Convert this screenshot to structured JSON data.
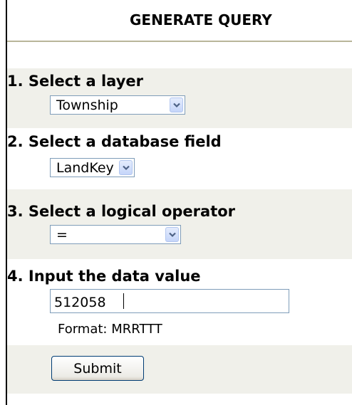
{
  "header": {
    "title": "GENERATE QUERY"
  },
  "steps": [
    {
      "heading": "1. Select a layer",
      "selected": "Township"
    },
    {
      "heading": "2. Select a database field",
      "selected": "LandKey"
    },
    {
      "heading": "3. Select a logical operator",
      "selected": "="
    },
    {
      "heading": "4. Input the data value",
      "value": "512058",
      "note": "Format: MRRTTT"
    }
  ],
  "submit_label": "Submit",
  "icons": {
    "dropdown": "chevron-down-icon"
  },
  "colors": {
    "section_shading": "#f0f0ea",
    "rule": "#b9b69a",
    "input_border": "#7f9db9",
    "dropdown_arrow": "#4d6185"
  }
}
